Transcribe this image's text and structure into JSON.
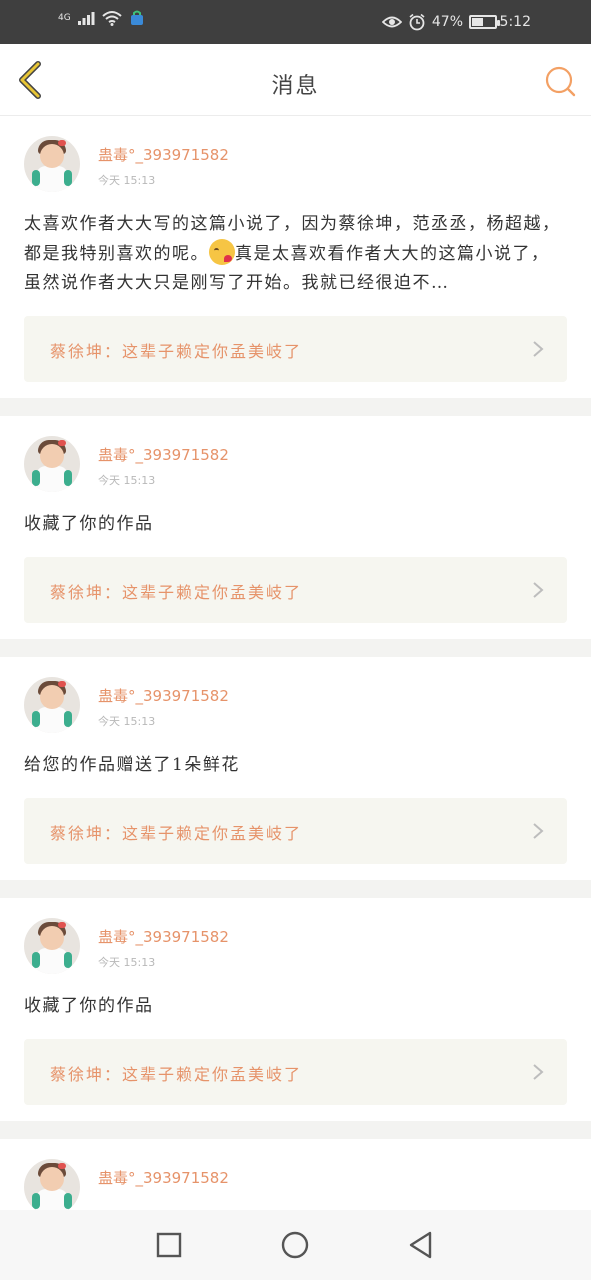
{
  "status_bar": {
    "network": "4G",
    "battery": "47%",
    "battery_level": 0.47,
    "time": "5:12"
  },
  "header": {
    "title": "消息"
  },
  "messages": [
    {
      "user": "蛊毒°_393971582",
      "time": "今天 15:13",
      "content_a": "太喜欢作者大大写的这篇小说了，因为蔡徐坤，范丞丞，杨超越，都是我特别喜欢的呢。",
      "content_b": "真是太喜欢看作者大大的这篇小说了，虽然说作者大大只是刚写了开始。我就已经很迫不…",
      "quote": "蔡徐坤：这辈子赖定你孟美岐了"
    },
    {
      "user": "蛊毒°_393971582",
      "time": "今天 15:13",
      "content": "收藏了你的作品",
      "quote": "蔡徐坤：这辈子赖定你孟美岐了"
    },
    {
      "user": "蛊毒°_393971582",
      "time": "今天 15:13",
      "content": "给您的作品赠送了1朵鲜花",
      "quote": "蔡徐坤：这辈子赖定你孟美岐了"
    },
    {
      "user": "蛊毒°_393971582",
      "time": "今天 15:13",
      "content": "收藏了你的作品",
      "quote": "蔡徐坤：这辈子赖定你孟美岐了"
    },
    {
      "user": "蛊毒°_393971582"
    }
  ],
  "colors": {
    "accent": "#e6936a",
    "header_icon": "#f3a064",
    "back_icon": "#e8c636"
  }
}
